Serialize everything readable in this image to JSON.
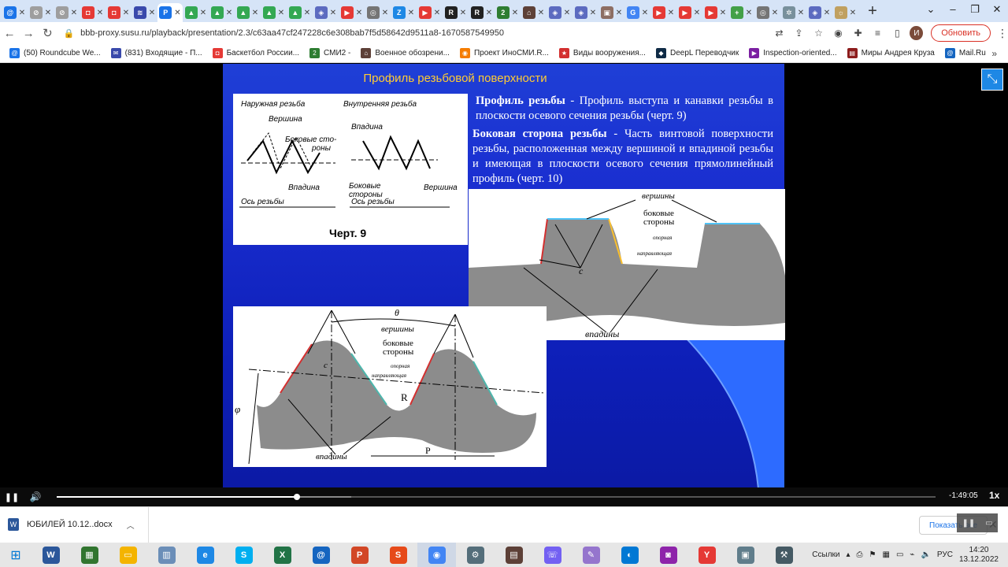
{
  "tabs": [
    {
      "icon": "at-icon",
      "color": "#1a73e8",
      "glyph": "@"
    },
    {
      "icon": "blocked-icon",
      "color": "#9e9e9e",
      "glyph": "⊘"
    },
    {
      "icon": "blocked-icon",
      "color": "#9e9e9e",
      "glyph": "⊘"
    },
    {
      "icon": "hockey-icon",
      "color": "#e53935",
      "glyph": "◘"
    },
    {
      "icon": "hockey-icon",
      "color": "#e53935",
      "glyph": "◘"
    },
    {
      "icon": "notebook-icon",
      "color": "#3949ab",
      "glyph": "≋"
    },
    {
      "icon": "presentation-icon",
      "color": "#1a73e8",
      "glyph": "P",
      "active": true
    },
    {
      "icon": "drive-icon",
      "color": "#34a853",
      "glyph": "▲"
    },
    {
      "icon": "drive-icon",
      "color": "#34a853",
      "glyph": "▲"
    },
    {
      "icon": "drive-icon",
      "color": "#34a853",
      "glyph": "▲"
    },
    {
      "icon": "drive-icon",
      "color": "#34a853",
      "glyph": "▲"
    },
    {
      "icon": "drive-icon",
      "color": "#34a853",
      "glyph": "▲"
    },
    {
      "icon": "cube-icon",
      "color": "#5c6bc0",
      "glyph": "◈"
    },
    {
      "icon": "youtube-icon",
      "color": "#e53935",
      "glyph": "▶"
    },
    {
      "icon": "globe-icon",
      "color": "#757575",
      "glyph": "◎"
    },
    {
      "icon": "zen-icon",
      "color": "#1e88e5",
      "glyph": "Z"
    },
    {
      "icon": "youtube-icon",
      "color": "#e53935",
      "glyph": "▶"
    },
    {
      "icon": "r-icon",
      "color": "#212121",
      "glyph": "R"
    },
    {
      "icon": "r-icon",
      "color": "#212121",
      "glyph": "R"
    },
    {
      "icon": "two-icon",
      "color": "#2e7d32",
      "glyph": "2"
    },
    {
      "icon": "mil-icon",
      "color": "#5d4037",
      "glyph": "⌂"
    },
    {
      "icon": "cube-icon",
      "color": "#5c6bc0",
      "glyph": "◈"
    },
    {
      "icon": "cube-icon",
      "color": "#5c6bc0",
      "glyph": "◈"
    },
    {
      "icon": "book-icon",
      "color": "#8d6e63",
      "glyph": "▣"
    },
    {
      "icon": "google-icon",
      "color": "#4285f4",
      "glyph": "G"
    },
    {
      "icon": "youtube-icon",
      "color": "#e53935",
      "glyph": "▶"
    },
    {
      "icon": "youtube-icon",
      "color": "#e53935",
      "glyph": "▶"
    },
    {
      "icon": "youtube-icon",
      "color": "#e53935",
      "glyph": "▶"
    },
    {
      "icon": "plus-green-icon",
      "color": "#43a047",
      "glyph": "+"
    },
    {
      "icon": "globe-icon",
      "color": "#757575",
      "glyph": "◎"
    },
    {
      "icon": "gear-icon",
      "color": "#78909c",
      "glyph": "✲"
    },
    {
      "icon": "cube-icon",
      "color": "#5c6bc0",
      "glyph": "◈"
    },
    {
      "icon": "sun-icon",
      "color": "#c0a060",
      "glyph": "☼"
    }
  ],
  "toolbar": {
    "url": "bbb-proxy.susu.ru/playback/presentation/2.3/c63aa47cf247228c6e308bab7f5d58642d9511a8-1670587549950",
    "update_label": "Обновить",
    "profile_letter": "И"
  },
  "bookmarks": [
    {
      "label": "(50) Roundcube We...",
      "color": "#1a73e8",
      "glyph": "@"
    },
    {
      "label": "(831) Входящие - П...",
      "color": "#3949ab",
      "glyph": "✉"
    },
    {
      "label": "Баскетбол России...",
      "color": "#e53935",
      "glyph": "◘"
    },
    {
      "label": "СМИ2 -",
      "color": "#2e7d32",
      "glyph": "2"
    },
    {
      "label": "Военное обозрени...",
      "color": "#5d4037",
      "glyph": "⌂"
    },
    {
      "label": "Проект ИноСМИ.R...",
      "color": "#f57c00",
      "glyph": "◉"
    },
    {
      "label": "Виды вооружения...",
      "color": "#d32f2f",
      "glyph": "★"
    },
    {
      "label": "DeepL Переводчик",
      "color": "#0f2b46",
      "glyph": "◆"
    },
    {
      "label": "Inspection-oriented...",
      "color": "#7b1fa2",
      "glyph": "▶"
    },
    {
      "label": "Миры Андрея Круза",
      "color": "#8d1c1c",
      "glyph": "▤"
    },
    {
      "label": "Mail.Ru",
      "color": "#1565c0",
      "glyph": "@"
    }
  ],
  "slide": {
    "title": "Профиль резьбовой поверхности",
    "term1": "Профиль резьбы",
    "def1": " - Профиль выступа и канавки резьбы в плоскости осевого сечения резьбы (черт. 9)",
    "term2": "Боковая сторона резьбы",
    "def2": " - Часть винтовой поверхности резьбы, расположенная между вершиной и впадиной резьбы и имеющая в плоскости осевого сечения прямолинейный профиль (черт. 10)",
    "fig9": {
      "outer": "Наружная резьба",
      "inner": "Внутренняя резьба",
      "peak": "Вершина",
      "sides": "Боковые сто-\nроны",
      "trough": "Впадина",
      "trough2": "Впадина",
      "sides2": "Боковые\nстороны",
      "peak2": "Вершина",
      "axis": "Ось резьбы",
      "axis2": "Ось резьбы",
      "caption": "Черт. 9"
    },
    "fig10": {
      "peaks": "вершины",
      "sides": "боковые\nстороны",
      "support": "опорная",
      "guide": "направляющая",
      "c": "c",
      "troughs": "впадины"
    },
    "fig11": {
      "theta": "θ",
      "peaks": "вершины",
      "sides": "боковые\nстороны",
      "support": "опорная",
      "guide": "направляющая",
      "c": "c",
      "r": "R",
      "phi": "φ",
      "troughs": "впадины",
      "p": "P"
    }
  },
  "player": {
    "time_left": "-1:49:05",
    "speed": "1x",
    "progress": 0.273,
    "buffered": 0.335
  },
  "downloads": {
    "file": "ЮБИЛЕЙ 10.12..docx",
    "show_all": "Показать все"
  },
  "taskbar": {
    "apps": [
      {
        "icon": "word-icon",
        "color": "#2b579a",
        "glyph": "W"
      },
      {
        "icon": "project-icon",
        "color": "#31752f",
        "glyph": "▦"
      },
      {
        "icon": "explorer-icon",
        "color": "#f4b400",
        "glyph": "▭"
      },
      {
        "icon": "folder-icon",
        "color": "#6b8eb8",
        "glyph": "▥"
      },
      {
        "icon": "ie-icon",
        "color": "#1e88e5",
        "glyph": "e"
      },
      {
        "icon": "skype-icon",
        "color": "#00aff0",
        "glyph": "S"
      },
      {
        "icon": "excel-icon",
        "color": "#217346",
        "glyph": "X"
      },
      {
        "icon": "mail-icon",
        "color": "#1565c0",
        "glyph": "@"
      },
      {
        "icon": "powerpoint-icon",
        "color": "#d24726",
        "glyph": "P"
      },
      {
        "icon": "s-app-icon",
        "color": "#e64a19",
        "glyph": "S"
      },
      {
        "icon": "chrome-icon",
        "color": "#4285f4",
        "glyph": "◉",
        "active": true
      },
      {
        "icon": "tools-icon",
        "color": "#546e7a",
        "glyph": "⚙"
      },
      {
        "icon": "calendar-icon",
        "color": "#5d4037",
        "glyph": "▤"
      },
      {
        "icon": "viber-icon",
        "color": "#7360f2",
        "glyph": "☏"
      },
      {
        "icon": "feather-icon",
        "color": "#9575cd",
        "glyph": "✎"
      },
      {
        "icon": "edge-icon",
        "color": "#0078d4",
        "glyph": "◐"
      },
      {
        "icon": "camera-icon",
        "color": "#8e24aa",
        "glyph": "◙"
      },
      {
        "icon": "yandex-icon",
        "color": "#e53935",
        "glyph": "Y"
      },
      {
        "icon": "screen-icon",
        "color": "#607d8b",
        "glyph": "▣"
      },
      {
        "icon": "tool2-icon",
        "color": "#455a64",
        "glyph": "⚒"
      }
    ],
    "links_label": "Ссылки",
    "lang": "РУС",
    "time": "14:20",
    "date": "13.12.2022"
  }
}
